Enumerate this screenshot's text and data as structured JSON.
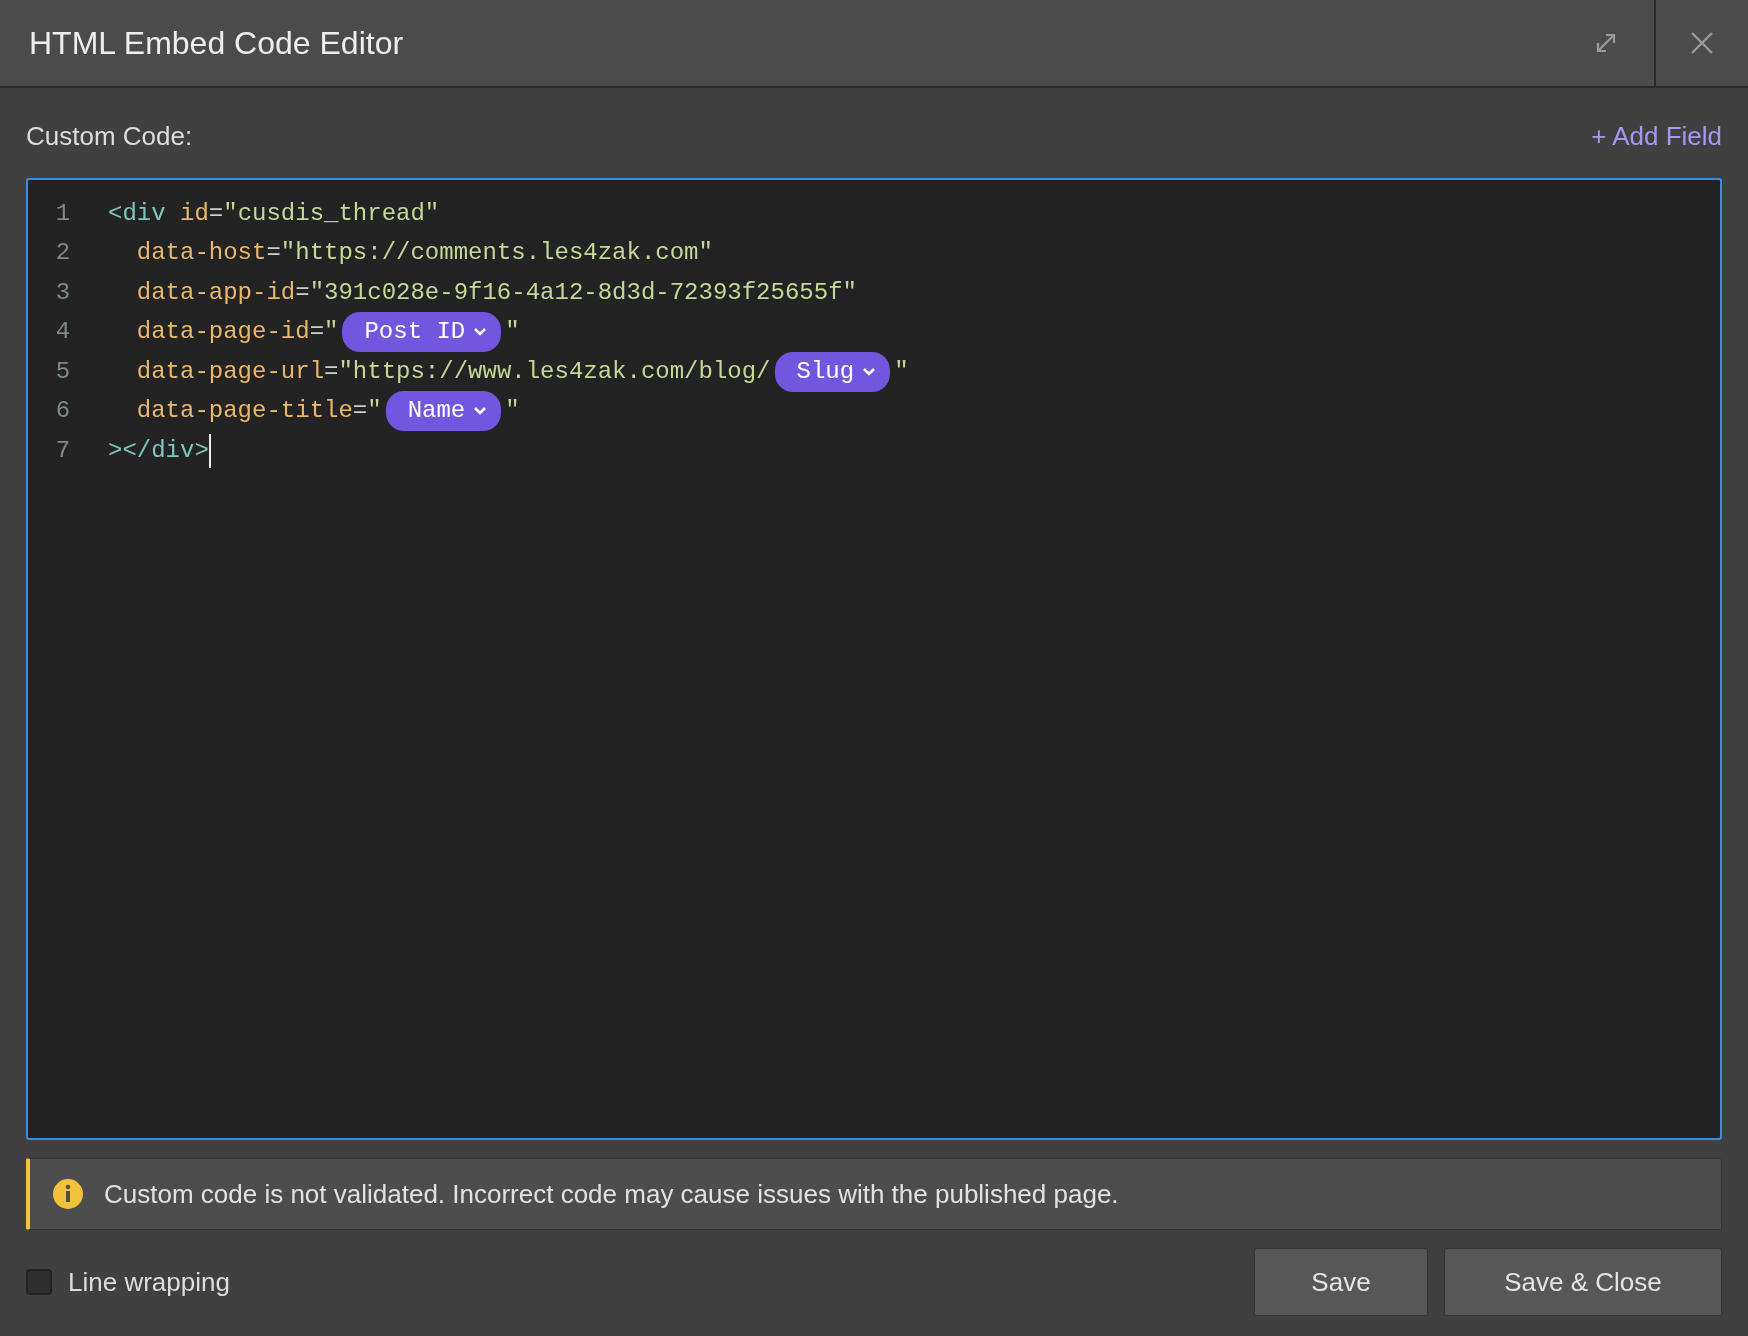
{
  "window": {
    "title": "HTML Embed Code Editor"
  },
  "editor": {
    "label": "Custom Code:",
    "add_field": "+ Add Field",
    "lines": [
      {
        "number": "1",
        "cursor": false,
        "segments": [
          {
            "kind": "tag",
            "text": "<div"
          },
          {
            "kind": "attr",
            "text": " id"
          },
          {
            "kind": "punct",
            "text": "="
          },
          {
            "kind": "string",
            "text": "\"cusdis_thread\""
          }
        ]
      },
      {
        "number": "2",
        "cursor": false,
        "segments": [
          {
            "kind": "attr",
            "text": "  data-host"
          },
          {
            "kind": "punct",
            "text": "="
          },
          {
            "kind": "string",
            "text": "\"https://comments.les4zak.com\""
          }
        ]
      },
      {
        "number": "3",
        "cursor": false,
        "segments": [
          {
            "kind": "attr",
            "text": "  data-app-id"
          },
          {
            "kind": "punct",
            "text": "="
          },
          {
            "kind": "string",
            "text": "\"391c028e-9f16-4a12-8d3d-72393f25655f\""
          }
        ]
      },
      {
        "number": "4",
        "cursor": false,
        "segments": [
          {
            "kind": "attr",
            "text": "  data-page-id"
          },
          {
            "kind": "punct",
            "text": "="
          },
          {
            "kind": "string",
            "text": "\""
          },
          {
            "kind": "token",
            "text": "Post ID"
          },
          {
            "kind": "string",
            "text": "\""
          }
        ]
      },
      {
        "number": "5",
        "cursor": false,
        "segments": [
          {
            "kind": "attr",
            "text": "  data-page-url"
          },
          {
            "kind": "punct",
            "text": "="
          },
          {
            "kind": "string",
            "text": "\"https://www.les4zak.com/blog/"
          },
          {
            "kind": "token",
            "text": "Slug"
          },
          {
            "kind": "string",
            "text": "\""
          }
        ]
      },
      {
        "number": "6",
        "cursor": false,
        "segments": [
          {
            "kind": "attr",
            "text": "  data-page-title"
          },
          {
            "kind": "punct",
            "text": "="
          },
          {
            "kind": "string",
            "text": "\""
          },
          {
            "kind": "token",
            "text": "Name"
          },
          {
            "kind": "string",
            "text": "\""
          }
        ]
      },
      {
        "number": "7",
        "cursor": true,
        "segments": [
          {
            "kind": "tag",
            "text": "></div>"
          }
        ]
      }
    ]
  },
  "warning": "Custom code is not validated. Incorrect code may cause issues with the published page.",
  "line_wrapping": {
    "label": "Line wrapping",
    "checked": false
  },
  "buttons": [
    "Save",
    "Save & Close"
  ]
}
